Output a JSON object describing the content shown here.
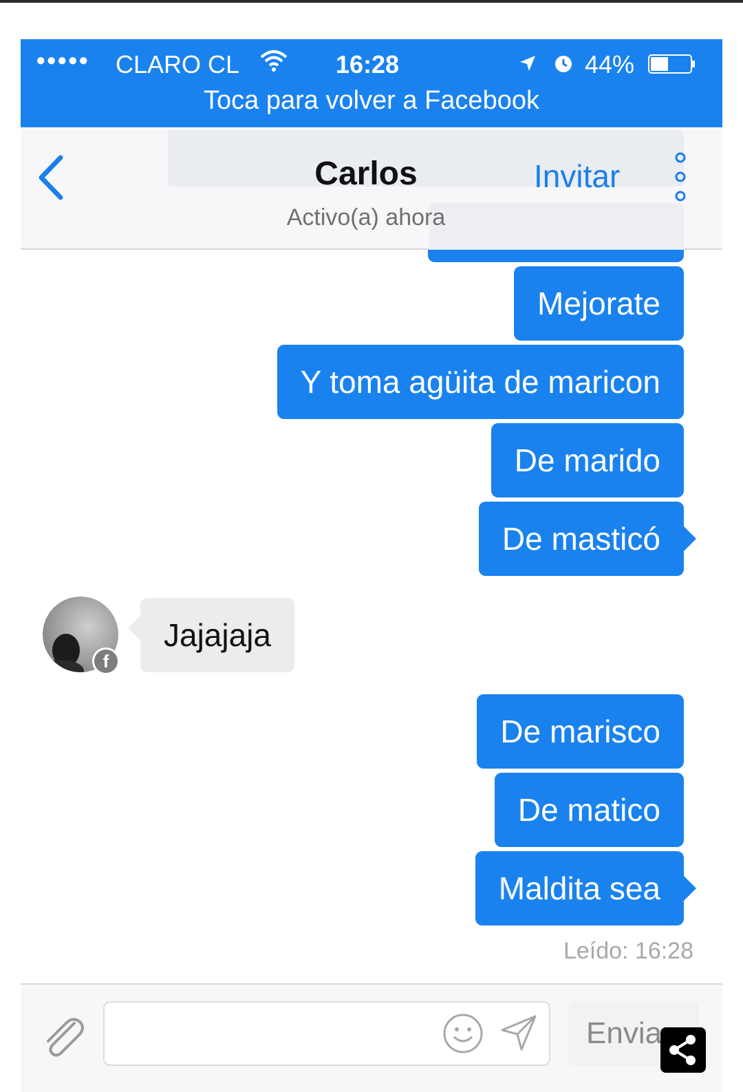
{
  "status_bar": {
    "signal_dots": "●●●●●",
    "carrier": "CLARO CL",
    "time": "16:28",
    "battery_percent": "44%",
    "battery_level": 0.44,
    "banner": "Toca para volver a Facebook"
  },
  "header": {
    "back_icon": "chevron-left-icon",
    "title": "Carlos",
    "subtitle": "Activo(a) ahora",
    "invite_label": "Invitar",
    "more_icon": "vertical-dots-icon"
  },
  "messages": [
    {
      "from": "me",
      "text": "Mejorate"
    },
    {
      "from": "me",
      "text": "Y toma agüita de maricon"
    },
    {
      "from": "me",
      "text": "De marido"
    },
    {
      "from": "me",
      "text": "De masticó"
    },
    {
      "from": "them",
      "text": "Jajajaja"
    },
    {
      "from": "me",
      "text": "De marisco"
    },
    {
      "from": "me",
      "text": "De matico"
    },
    {
      "from": "me",
      "text": "Maldita sea"
    }
  ],
  "read_receipt": "Leído: 16:28",
  "composer": {
    "input_value": "",
    "send_label": "Envia"
  },
  "colors": {
    "accent": "#1a82ee",
    "incoming_bubble": "#ececec"
  }
}
